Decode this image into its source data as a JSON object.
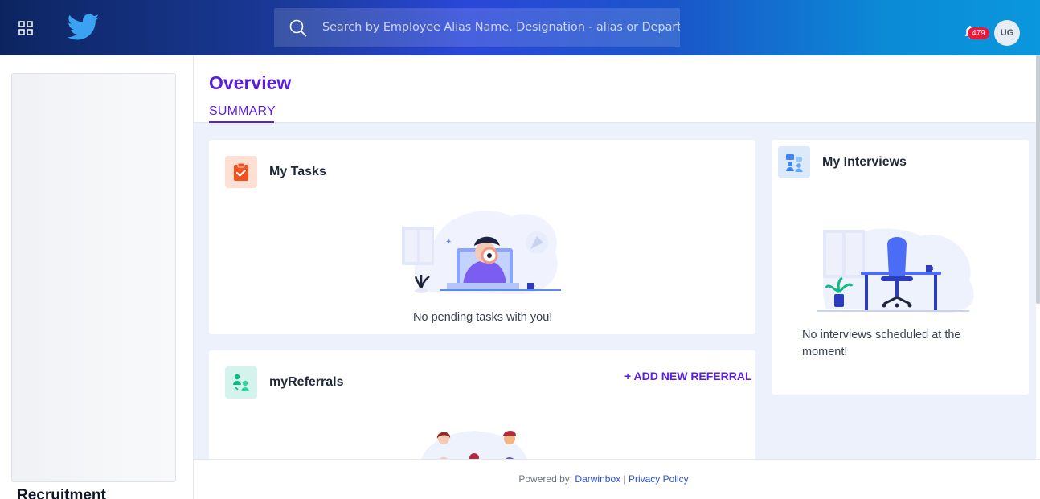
{
  "header": {
    "apps_icon": "apps-grid-icon",
    "logo_icon": "twitter-bird-icon",
    "search": {
      "icon": "search-icon",
      "placeholder": "Search by Employee Alias Name, Designation - alias or Department - alias"
    },
    "notifications": {
      "icon": "bell-icon",
      "count": "479"
    },
    "avatar_initials": "UG"
  },
  "sidebar": {
    "section_title": "Recruitment"
  },
  "page": {
    "title": "Overview",
    "tabs": [
      {
        "label": "SUMMARY",
        "active": true
      }
    ]
  },
  "cards": {
    "tasks": {
      "title": "My Tasks",
      "icon": "clipboard-check-icon",
      "empty_message": "No pending tasks with you!"
    },
    "interviews": {
      "title": "My Interviews",
      "icon": "interview-people-icon",
      "empty_message_line1": "No interviews scheduled at the",
      "empty_message_line2": "moment!"
    },
    "referrals": {
      "title": "myReferrals",
      "icon": "referral-people-icon",
      "add_label": "+ ADD NEW REFERRAL"
    }
  },
  "footer": {
    "powered_by": "Powered by:",
    "brand_link": "Darwinbox",
    "separator": "|",
    "privacy_link": "Privacy Policy"
  },
  "colors": {
    "accent": "#5b1ee0",
    "badge": "#e8183a",
    "tasks_icon_bg": "#fde0d3",
    "referrals_icon_bg": "#d3f3ec",
    "interviews_icon_bg": "#dbe9fb"
  }
}
